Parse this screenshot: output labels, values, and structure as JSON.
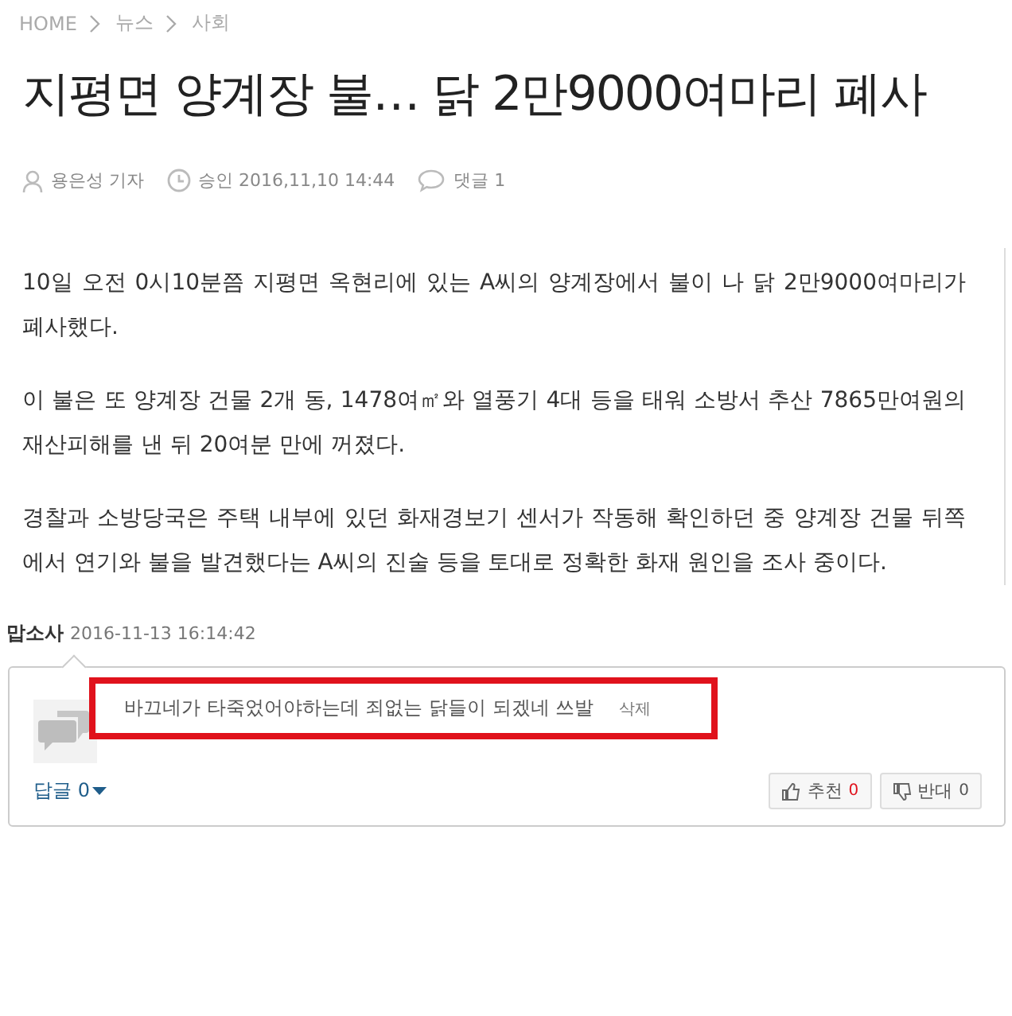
{
  "breadcrumb": [
    "HOME",
    "뉴스",
    "사회"
  ],
  "headline": "지평면 양계장 불… 닭 2만9000여마리 폐사",
  "meta": {
    "author": "용은성 기자",
    "approved": "승인 2016,11,10 14:44",
    "comments": "댓글 1"
  },
  "paragraphs": [
    "10일 오전 0시10분쯤 지평면 옥현리에 있는 A씨의 양계장에서 불이 나 닭 2만9000여마리가 폐사했다.",
    "이 불은 또 양계장 건물 2개 동, 1478여㎡와 열풍기 4대 등을 태워 소방서 추산 7865만여원의 재산피해를 낸 뒤 20여분 만에 꺼졌다.",
    "경찰과 소방당국은 주택 내부에 있던 화재경보기 센서가 작동해 확인하던 중 양계장 건물 뒤쪽에서 연기와 불을 발견했다는 A씨의 진술 등을 토대로 정확한 화재 원인을 조사 중이다."
  ],
  "comment": {
    "user": "맙소사",
    "time": "2016-11-13 16:14:42",
    "text": "바끄네가 타죽었어야하는데 죄없는 닭들이 되겠네 쓰발",
    "delete": "삭제",
    "highlighted": true,
    "replies": "답글 0",
    "up_label": "추천",
    "up_count": "0",
    "down_label": "반대",
    "down_count": "0"
  }
}
